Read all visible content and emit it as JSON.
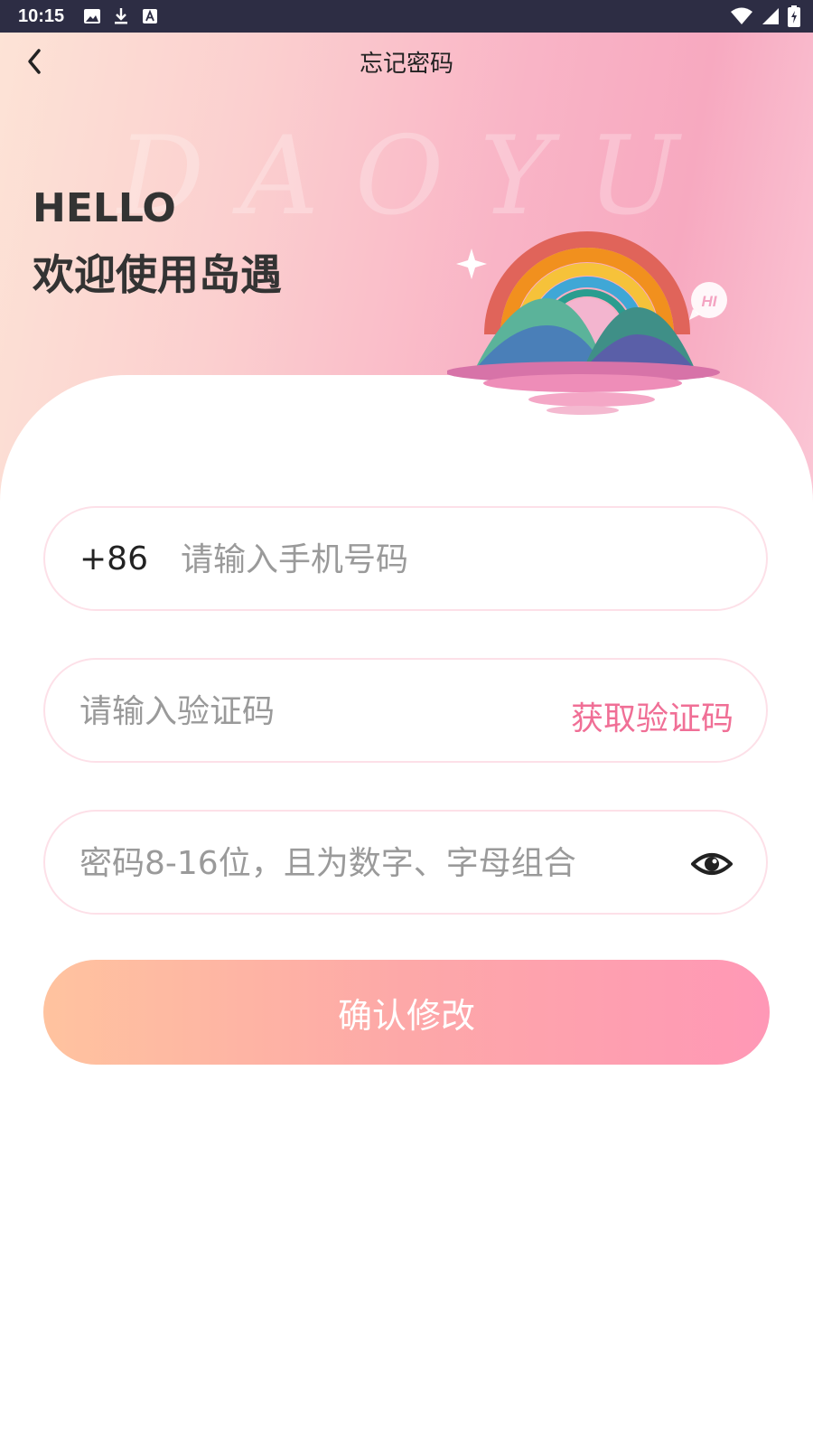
{
  "status_bar": {
    "time": "10:15",
    "left_icons": [
      "image-icon",
      "download-icon",
      "font-icon"
    ],
    "right_icons": [
      "wifi-icon",
      "signal-icon",
      "battery-icon"
    ]
  },
  "header": {
    "title": "忘记密码",
    "back_icon": "chevron-left-icon",
    "watermark": "DAOYU",
    "greeting": "HELLO",
    "welcome": "欢迎使用岛遇"
  },
  "form": {
    "phone": {
      "country_code": "+86",
      "placeholder": "请输入手机号码",
      "value": ""
    },
    "code": {
      "placeholder": "请输入验证码",
      "value": "",
      "get_code_label": "获取验证码"
    },
    "password": {
      "placeholder": "密码8-16位，且为数字、字母组合",
      "value": "",
      "toggle_icon": "eye-icon"
    },
    "submit_label": "确认修改"
  },
  "colors": {
    "accent": "#f06f96",
    "button_gradient_start": "#ffc39f",
    "button_gradient_end": "#ff98b6",
    "field_border": "#fde0e8"
  }
}
